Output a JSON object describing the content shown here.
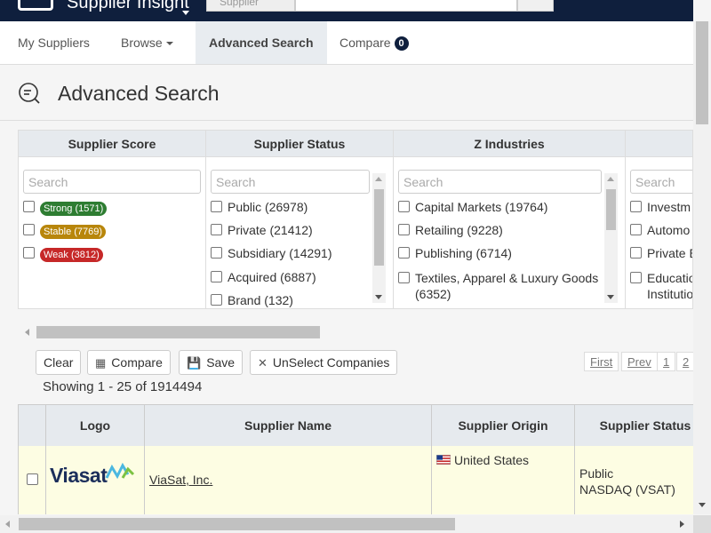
{
  "header": {
    "brand": "Supplier Insight",
    "search_type": "Supplier"
  },
  "nav": {
    "items": [
      {
        "label": "My Suppliers"
      },
      {
        "label": "Browse"
      },
      {
        "label": "Advanced Search"
      },
      {
        "label": "Compare",
        "badge": "0"
      }
    ],
    "active": "Advanced Search"
  },
  "page": {
    "title": "Advanced Search"
  },
  "facets": [
    {
      "title": "Supplier Score",
      "search_placeholder": "Search",
      "options": [
        {
          "label": "Strong (1571)",
          "color": "#2e7d32"
        },
        {
          "label": "Stable (7769)",
          "color": "#b8860b"
        },
        {
          "label": "Weak (3812)",
          "color": "#c62828"
        }
      ]
    },
    {
      "title": "Supplier Status",
      "search_placeholder": "Search",
      "options": [
        {
          "label": "Public (26978)"
        },
        {
          "label": "Private (21412)"
        },
        {
          "label": "Subsidiary (14291)"
        },
        {
          "label": "Acquired (6887)"
        },
        {
          "label": "Brand (132)"
        }
      ]
    },
    {
      "title": "Z Industries",
      "search_placeholder": "Search",
      "options": [
        {
          "label": "Capital Markets (19764)"
        },
        {
          "label": "Retailing (9228)"
        },
        {
          "label": "Publishing (6714)"
        },
        {
          "label": "Textiles, Apparel & Luxury Goods",
          "label2": "(6352)"
        }
      ]
    },
    {
      "title": "",
      "search_placeholder": "Search",
      "options": [
        {
          "label": "Investm"
        },
        {
          "label": "Automo"
        },
        {
          "label": "Private E"
        },
        {
          "label": "Educatio",
          "label2": "Institutio"
        }
      ]
    }
  ],
  "actions": {
    "clear": "Clear",
    "compare": "Compare",
    "save": "Save",
    "unselect": "UnSelect Companies"
  },
  "pager": {
    "first": "First",
    "prev": "Prev",
    "pages": [
      "1",
      "2"
    ]
  },
  "results": {
    "showing": "Showing 1 - 25 of 1914494",
    "columns": [
      "",
      "Logo",
      "Supplier Name",
      "Supplier Origin",
      "Supplier Status"
    ],
    "rows": [
      {
        "logo_text": "Viasat",
        "name": "ViaSat, Inc.",
        "origin": "United States",
        "status_line1": "Public",
        "status_line2": "NASDAQ (VSAT)"
      }
    ]
  },
  "colors": {
    "navy": "#0f1f3d",
    "header_bg": "#e6eaee",
    "row_highlight": "#fdfde3"
  }
}
